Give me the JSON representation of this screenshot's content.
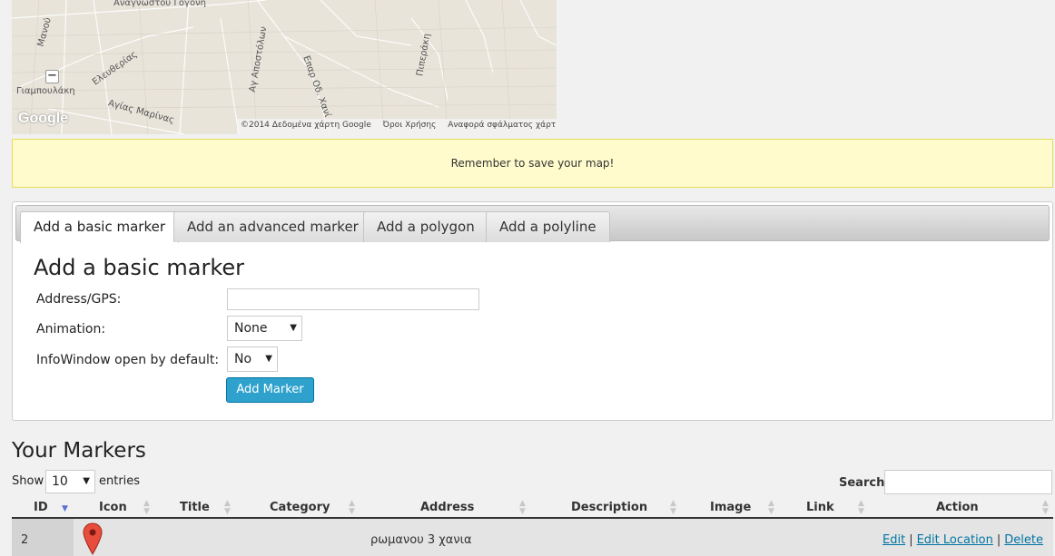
{
  "map": {
    "streets": [
      "Αναγνώστου Γογονή",
      "Μανού",
      "Γιαμπουλάκη",
      "Ελευθερίας",
      "Αγίας Μαρίνας",
      "Αγ Αποστόλων",
      "Επαρ Οδ. Χανί",
      "Πιπεράκη"
    ],
    "zoom_out_label": "−",
    "logo": "Google",
    "attribution": "©2014 Δεδομένα χάρτη Google",
    "terms": "Όροι Χρήσης",
    "report": "Αναφορά σφάλματος χάρτη"
  },
  "notice": {
    "text": "Remember to save your map!"
  },
  "tabs": [
    {
      "label": "Add a basic marker",
      "active": true
    },
    {
      "label": "Add an advanced marker",
      "active": false
    },
    {
      "label": "Add a polygon",
      "active": false
    },
    {
      "label": "Add a polyline",
      "active": false
    }
  ],
  "form": {
    "heading": "Add a basic marker",
    "address_label": "Address/GPS:",
    "address_value": "",
    "animation_label": "Animation:",
    "animation_value": "None",
    "infowindow_label": "InfoWindow open by default:",
    "infowindow_value": "No",
    "submit_label": "Add Marker"
  },
  "markers": {
    "heading": "Your Markers",
    "show_label": "Show",
    "page_size": "10",
    "entries_label": "entries",
    "search_label": "Search:",
    "columns": [
      "ID",
      "Icon",
      "Title",
      "Category",
      "Address",
      "Description",
      "Image",
      "Link",
      "Action"
    ],
    "rows": [
      {
        "id": "2",
        "icon": "map-pin-icon",
        "title": "",
        "category": "",
        "address": "ρωμανου 3 χανια",
        "description": "",
        "image": "",
        "link": "",
        "actions": [
          "Edit",
          "Edit Location",
          "Delete"
        ]
      }
    ]
  },
  "colors": {
    "accent": "#2ea2cc",
    "link": "#0074a2",
    "notice_bg": "#fffbcc",
    "marker_pin": "#e74c3c"
  }
}
